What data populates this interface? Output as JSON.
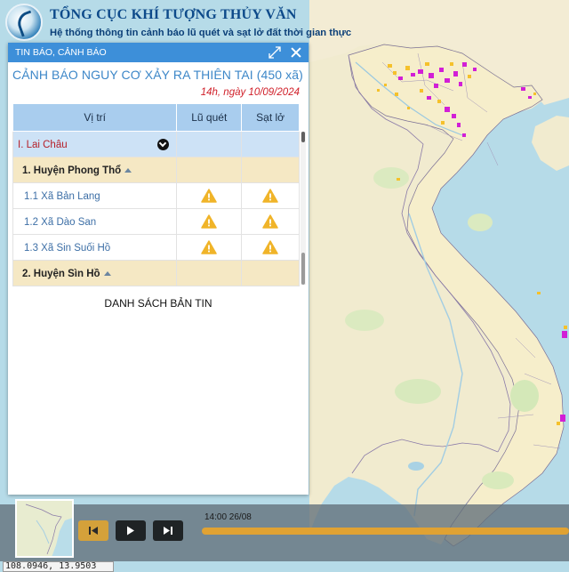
{
  "header": {
    "org_title": "TỔNG CỤC KHÍ TƯỢNG THỦY VĂN",
    "org_subtitle": "Hệ thống thông tin cảnh báo lũ quét và sạt lở đất thời gian thực"
  },
  "panel": {
    "bar_title": "TIN BÁO, CẢNH BÁO",
    "warning_title": "CẢNH BÁO NGUY CƠ XẢY RA THIÊN TAI (450 xã)",
    "date": "14h, ngày 10/09/2024",
    "table": {
      "headers": [
        "Vị trí",
        "Lũ quét",
        "Sạt lở"
      ],
      "province": "I. Lai Châu",
      "districts": [
        {
          "name": "1. Huyện Phong Thổ",
          "communes": [
            {
              "name": "1.1  Xã Bản Lang",
              "flash_flood": "warning",
              "landslide": "warning"
            },
            {
              "name": "1.2  Xã Dào San",
              "flash_flood": "warning",
              "landslide": "warning"
            },
            {
              "name": "1.3  Xã Sin Suối Hồ",
              "flash_flood": "warning",
              "landslide": "warning"
            }
          ]
        },
        {
          "name": "2. Huyện Sìn Hồ",
          "communes": []
        }
      ]
    },
    "news_title": "DANH SÁCH BẢN TIN"
  },
  "timeline": {
    "time_label": "14:00 26/08",
    "progress": 1.0
  },
  "coordinates": "108.0946, 13.9503",
  "icons": {
    "expand": "expand-icon",
    "close": "close-icon",
    "warning": "warning-triangle-icon",
    "prev": "skip-back-icon",
    "play": "play-icon",
    "next": "skip-forward-icon"
  },
  "colors": {
    "panel_bar": "#3d8fd9",
    "warning_icon": "#f0b429",
    "alert_magenta": "#d21fd6",
    "alert_orange": "#f5c12b",
    "timeline_accent": "#e0a233"
  }
}
